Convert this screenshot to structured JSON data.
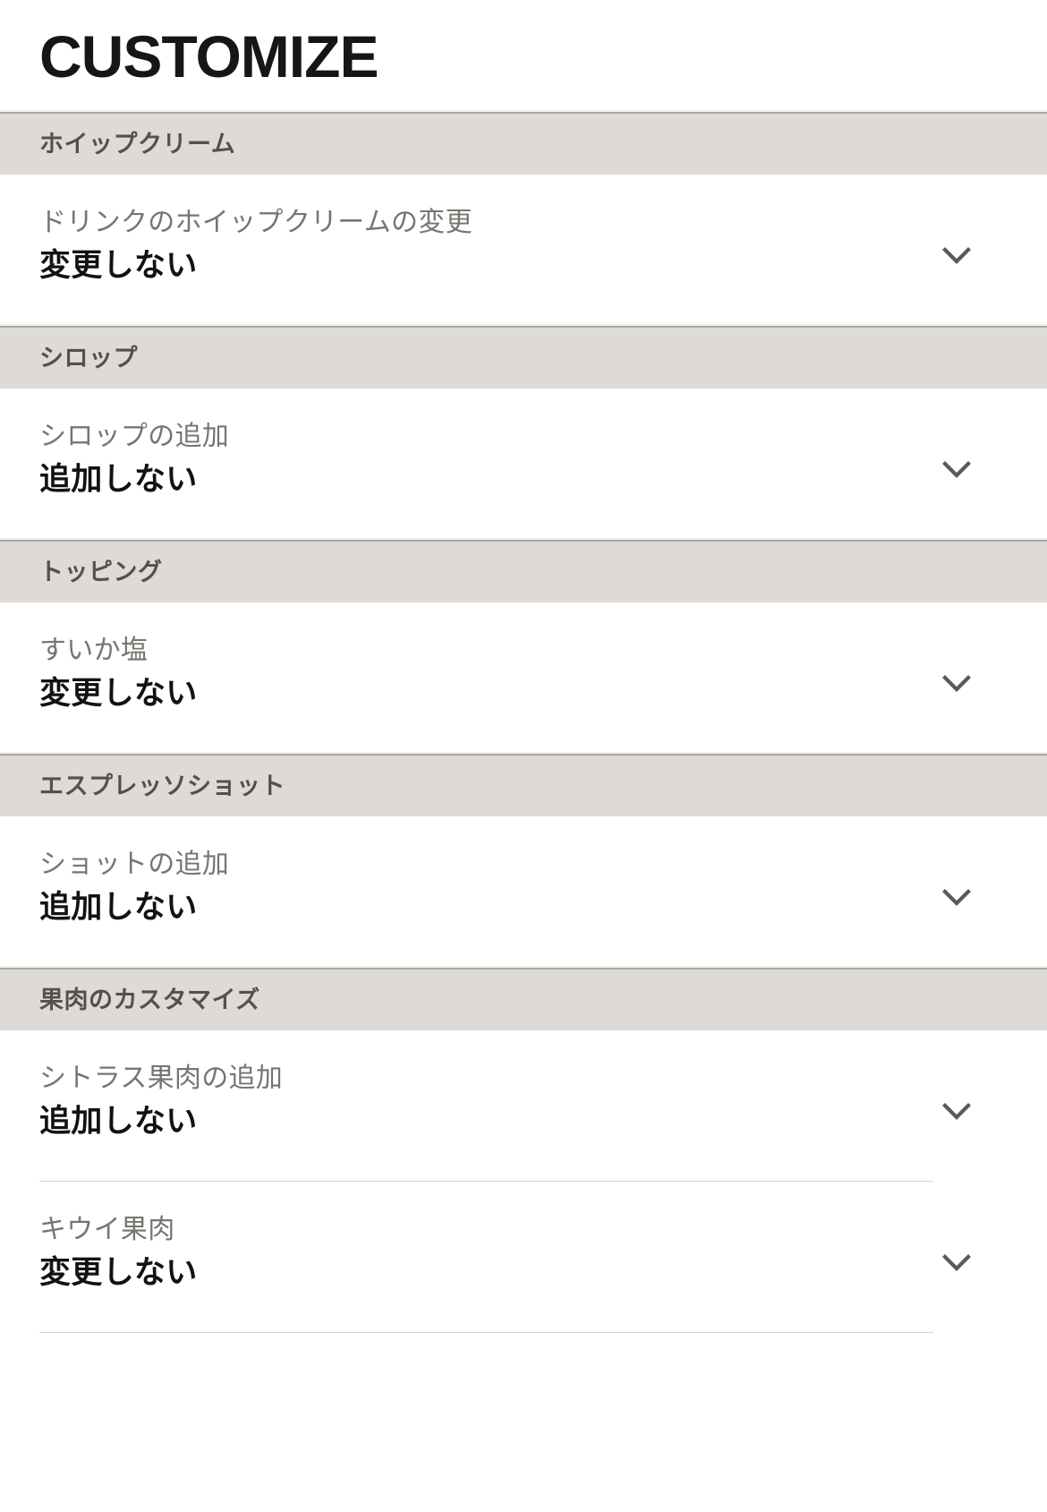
{
  "header": {
    "title": "CUSTOMIZE"
  },
  "colors": {
    "section_band": "#dedbd7",
    "section_band_border": "#a9a7a4",
    "section_label": "#54504c",
    "option_label": "#787470",
    "option_value": "#121212",
    "divider": "#d6d4d1",
    "page_background": "#ffffff",
    "title": "#161616"
  },
  "icons": {
    "chevron_down": "chevron-down-icon"
  },
  "sections": [
    {
      "title": "ホイップクリーム",
      "options": [
        {
          "label": "ドリンクのホイップクリームの変更",
          "value": "変更しない",
          "icon": "chevron-down-icon"
        }
      ]
    },
    {
      "title": "シロップ",
      "options": [
        {
          "label": "シロップの追加",
          "value": "追加しない",
          "icon": "chevron-down-icon"
        }
      ]
    },
    {
      "title": "トッピング",
      "options": [
        {
          "label": "すいか塩",
          "value": "変更しない",
          "icon": "chevron-down-icon"
        }
      ]
    },
    {
      "title": "エスプレッソショット",
      "options": [
        {
          "label": "ショットの追加",
          "value": "追加しない",
          "icon": "chevron-down-icon"
        }
      ]
    },
    {
      "title": "果肉のカスタマイズ",
      "options": [
        {
          "label": "シトラス果肉の追加",
          "value": "追加しない",
          "icon": "chevron-down-icon"
        },
        {
          "label": "キウイ果肉",
          "value": "変更しない",
          "icon": "chevron-down-icon"
        }
      ]
    }
  ]
}
